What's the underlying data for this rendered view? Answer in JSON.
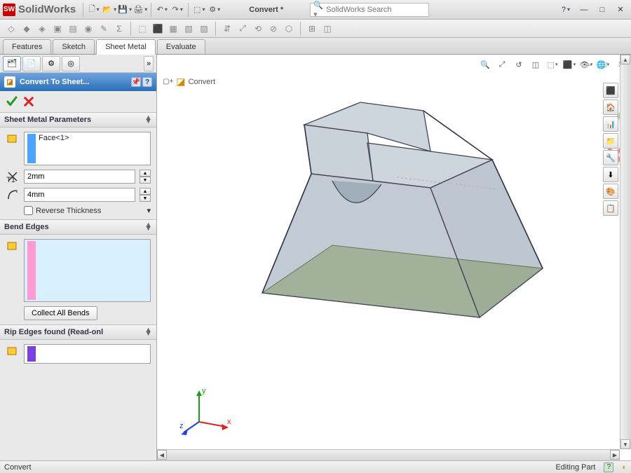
{
  "app": {
    "brand": "SolidWorks",
    "doc_title": "Convert *"
  },
  "search": {
    "placeholder": "SolidWorks Search"
  },
  "cmd_tabs": {
    "features": "Features",
    "sketch": "Sketch",
    "sheet_metal": "Sheet Metal",
    "evaluate": "Evaluate"
  },
  "feature_tree": {
    "root": "Convert"
  },
  "pm": {
    "title": "Convert To Sheet...",
    "groups": {
      "params": {
        "title": "Sheet Metal Parameters",
        "face_sel": "Face<1>",
        "thickness_value": "2mm",
        "bend_radius_value": "4mm",
        "reverse_label": "Reverse Thickness"
      },
      "bend": {
        "title": "Bend Edges",
        "collect_btn": "Collect All Bends"
      },
      "rip": {
        "title": "Rip Edges found (Read-onl"
      }
    }
  },
  "triad": {
    "x": "x",
    "y": "y",
    "z": "z"
  },
  "status": {
    "left": "Convert",
    "right": "Editing Part"
  },
  "icons": {
    "new": "🗋",
    "open": "📂",
    "save": "💾",
    "print": "🖨",
    "undo": "↶",
    "redo": "↷",
    "options": "⚙",
    "rebuild": "⟳",
    "select": "⬚",
    "zoom_fit": "🔍",
    "zoom_area": "⤢",
    "prev_view": "↺",
    "section": "◫",
    "view_orient": "⬚",
    "display_style": "⬛",
    "hide_show": "👁",
    "scene": "🌐",
    "cube": "◉",
    "arrow": "➤",
    "face": "▭",
    "thickness": "⇕",
    "radius": "⤷",
    "help": "?",
    "pin": "📌",
    "tp1": "⬛",
    "tp2": "🏠",
    "tp3": "📊",
    "tp4": "📁",
    "tp5": "🔧",
    "tp6": "⬇",
    "tp7": "🎨",
    "tp8": "📋"
  }
}
